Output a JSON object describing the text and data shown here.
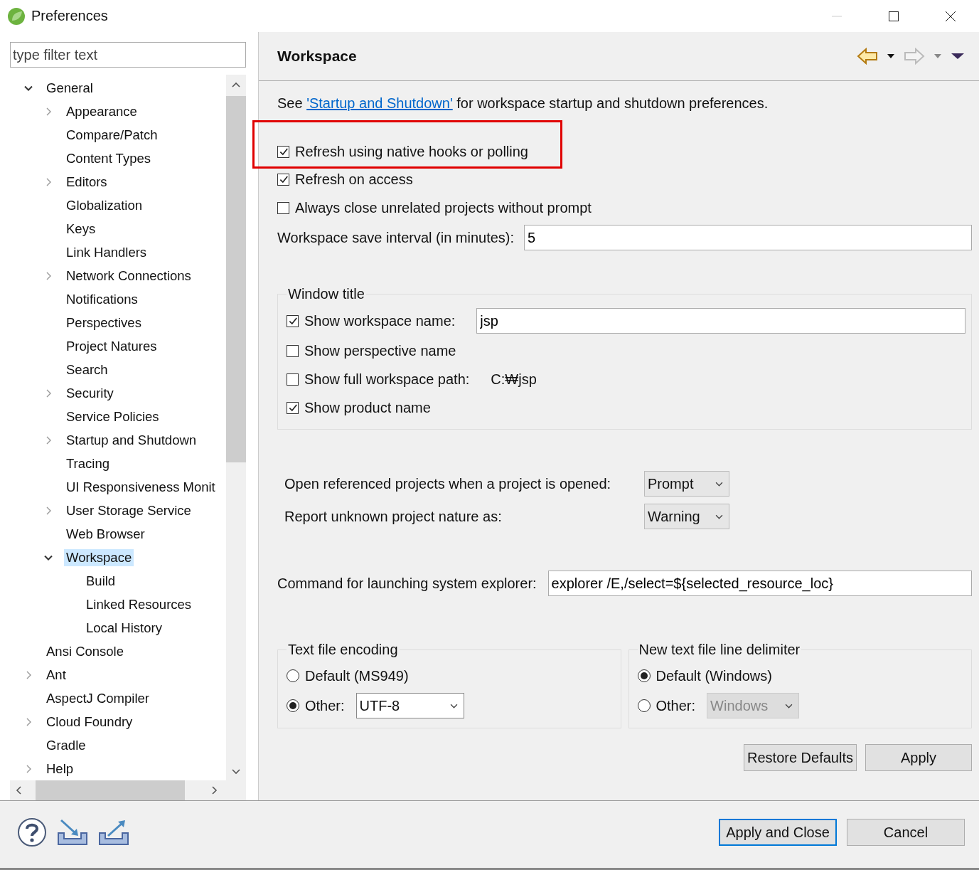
{
  "window": {
    "title": "Preferences"
  },
  "filter": {
    "placeholder": "type filter text"
  },
  "tree": [
    {
      "label": "General",
      "has_children": true,
      "expanded": true,
      "selected": false,
      "children": [
        {
          "label": "Appearance",
          "has_children": true,
          "expanded": false,
          "selected": false
        },
        {
          "label": "Compare/Patch",
          "has_children": false,
          "selected": false
        },
        {
          "label": "Content Types",
          "has_children": false,
          "selected": false
        },
        {
          "label": "Editors",
          "has_children": true,
          "expanded": false,
          "selected": false
        },
        {
          "label": "Globalization",
          "has_children": false,
          "selected": false
        },
        {
          "label": "Keys",
          "has_children": false,
          "selected": false
        },
        {
          "label": "Link Handlers",
          "has_children": false,
          "selected": false
        },
        {
          "label": "Network Connections",
          "has_children": true,
          "expanded": false,
          "selected": false
        },
        {
          "label": "Notifications",
          "has_children": false,
          "selected": false
        },
        {
          "label": "Perspectives",
          "has_children": false,
          "selected": false
        },
        {
          "label": "Project Natures",
          "has_children": false,
          "selected": false
        },
        {
          "label": "Search",
          "has_children": false,
          "selected": false
        },
        {
          "label": "Security",
          "has_children": true,
          "expanded": false,
          "selected": false
        },
        {
          "label": "Service Policies",
          "has_children": false,
          "selected": false
        },
        {
          "label": "Startup and Shutdown",
          "has_children": true,
          "expanded": false,
          "selected": false
        },
        {
          "label": "Tracing",
          "has_children": false,
          "selected": false
        },
        {
          "label": "UI Responsiveness Monit",
          "has_children": false,
          "selected": false
        },
        {
          "label": "User Storage Service",
          "has_children": true,
          "expanded": false,
          "selected": false
        },
        {
          "label": "Web Browser",
          "has_children": false,
          "selected": false
        },
        {
          "label": "Workspace",
          "has_children": true,
          "expanded": true,
          "selected": true,
          "children": [
            {
              "label": "Build",
              "has_children": false,
              "selected": false
            },
            {
              "label": "Linked Resources",
              "has_children": false,
              "selected": false
            },
            {
              "label": "Local History",
              "has_children": false,
              "selected": false
            }
          ]
        }
      ]
    },
    {
      "label": "Ansi Console",
      "has_children": false,
      "selected": false
    },
    {
      "label": "Ant",
      "has_children": true,
      "expanded": false,
      "selected": false
    },
    {
      "label": "AspectJ Compiler",
      "has_children": false,
      "selected": false
    },
    {
      "label": "Cloud Foundry",
      "has_children": true,
      "expanded": false,
      "selected": false
    },
    {
      "label": "Gradle",
      "has_children": false,
      "selected": false
    },
    {
      "label": "Help",
      "has_children": true,
      "expanded": false,
      "selected": false
    }
  ],
  "page": {
    "title": "Workspace",
    "intro": {
      "before": "See ",
      "link": "'Startup and Shutdown'",
      "after": " for workspace startup and shutdown preferences."
    },
    "options": [
      {
        "label": "Refresh using native hooks or polling",
        "checked": true,
        "highlighted": true
      },
      {
        "label": "Refresh on access",
        "checked": true,
        "highlighted": false
      },
      {
        "label": "Always close unrelated projects without prompt",
        "checked": false,
        "highlighted": false
      }
    ],
    "save_interval": {
      "label": "Workspace save interval (in minutes):",
      "value": "5"
    },
    "window_title": {
      "legend": "Window title",
      "items": [
        {
          "kind": "field",
          "label": "Show workspace name:",
          "checked": true,
          "value": "jsp"
        },
        {
          "kind": "plain",
          "label": "Show perspective name",
          "checked": false
        },
        {
          "kind": "path",
          "label": "Show full workspace path:",
          "checked": false,
          "value": "C:₩jsp"
        },
        {
          "kind": "plain",
          "label": "Show product name",
          "checked": true
        }
      ]
    },
    "combos": [
      {
        "label": "Open referenced projects when a project is opened:",
        "value": "Prompt"
      },
      {
        "label": "Report unknown project nature as:",
        "value": "Warning"
      }
    ],
    "explorer": {
      "label": "Command for launching system explorer:",
      "value": "explorer /E,/select=${selected_resource_loc}"
    },
    "encoding": {
      "legend": "Text file encoding",
      "options": [
        {
          "label": "Default (MS949)",
          "selected": false
        },
        {
          "label": "Other:",
          "selected": true,
          "combo": "UTF-8",
          "disabled": false
        }
      ]
    },
    "delimiter": {
      "legend": "New text file line delimiter",
      "options": [
        {
          "label": "Default (Windows)",
          "selected": true
        },
        {
          "label": "Other:",
          "selected": false,
          "combo": "Windows",
          "disabled": true
        }
      ]
    },
    "buttons": [
      "Restore Defaults",
      "Apply"
    ]
  },
  "footer": {
    "buttons": [
      {
        "label": "Apply and Close",
        "default": true
      },
      {
        "label": "Cancel",
        "default": false
      }
    ]
  }
}
